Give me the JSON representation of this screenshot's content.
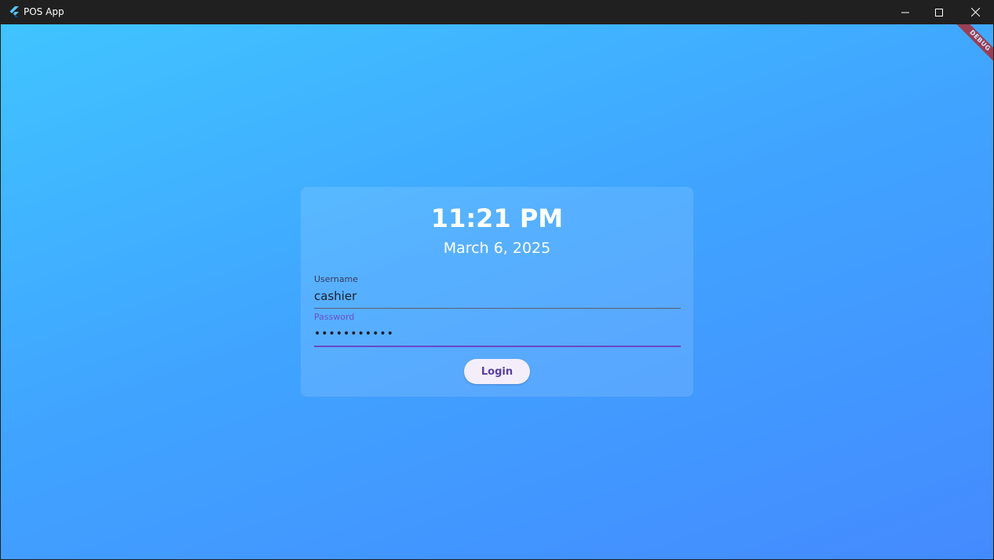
{
  "window": {
    "title": "POS App",
    "minimize_icon": "minimize-icon",
    "maximize_icon": "maximize-icon",
    "close_icon": "close-icon"
  },
  "debug_banner": {
    "label": "DEBUG"
  },
  "login": {
    "time": "11:21 PM",
    "date": "March 6, 2025",
    "username": {
      "label": "Username",
      "value": "cashier"
    },
    "password": {
      "label": "Password",
      "masked_value": "•••••••••••"
    },
    "login_button_label": "Login"
  },
  "colors": {
    "gradient_start": "#40c4ff",
    "gradient_end": "#448aff",
    "titlebar": "#202020",
    "focus_accent": "#6a48c8",
    "debug_ribbon": "#b71c1c"
  }
}
